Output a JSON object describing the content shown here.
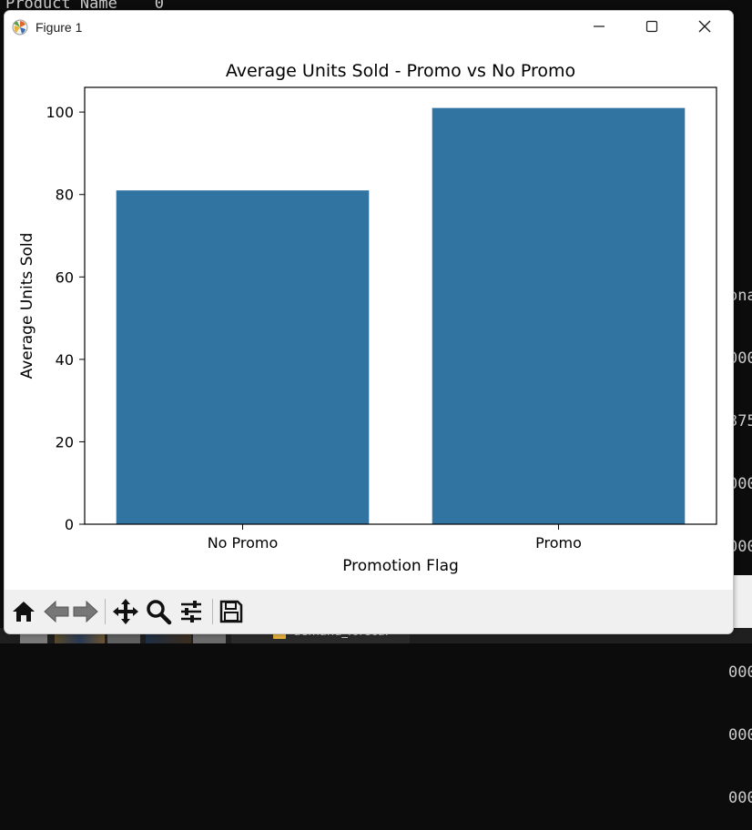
{
  "background": {
    "terminal_top_text": "Product Name    0",
    "terminal_right_lines": [
      "ona",
      "000",
      "375",
      "000",
      "000",
      "000",
      "000",
      "000",
      "000"
    ],
    "taskbar_folder_label": "demand_foreca."
  },
  "window": {
    "title": "Figure 1",
    "controls": {
      "minimize": "minimize-icon",
      "maximize": "maximize-icon",
      "close": "close-icon"
    }
  },
  "toolbar": {
    "tools": [
      "home-icon",
      "back-arrow-icon",
      "forward-arrow-icon",
      "pan-move-icon",
      "zoom-magnifier-icon",
      "configure-subplots-icon",
      "save-icon"
    ]
  },
  "colors": {
    "bar": "#3274a1",
    "terminal_bg": "#0c0c0c",
    "toolbar_bg": "#f0f0f0"
  },
  "chart_data": {
    "type": "bar",
    "title": "Average Units Sold - Promo vs No Promo",
    "xlabel": "Promotion Flag",
    "ylabel": "Average Units Sold",
    "categories": [
      "No Promo",
      "Promo"
    ],
    "values": [
      81,
      101
    ],
    "ylim": [
      0,
      106
    ],
    "yticks": [
      0,
      20,
      40,
      60,
      80,
      100
    ],
    "grid": false,
    "legend": "none"
  }
}
